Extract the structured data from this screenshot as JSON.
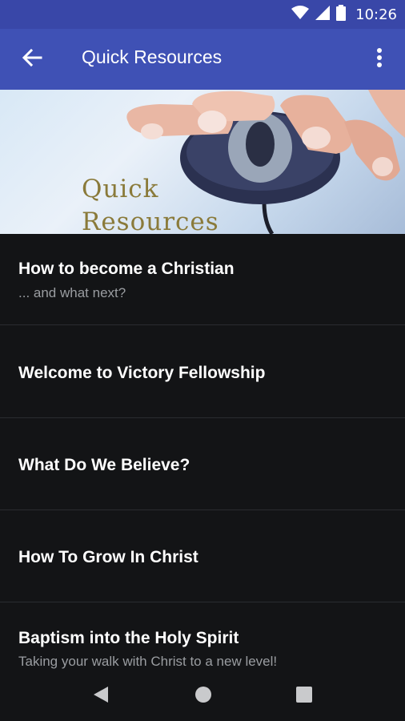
{
  "status_bar": {
    "time": "10:26",
    "icons": [
      "wifi-icon",
      "cell-signal-icon",
      "battery-icon"
    ]
  },
  "app_bar": {
    "title": "Quick Resources",
    "back_icon": "arrow-left-icon",
    "menu_icon": "more-vert-icon"
  },
  "hero": {
    "text_line1": "Quick",
    "text_line2": "Resources"
  },
  "list": {
    "items": [
      {
        "title": "How to become a Christian",
        "subtitle": "... and what next?"
      },
      {
        "title": "Welcome to Victory Fellowship",
        "subtitle": ""
      },
      {
        "title": "What Do We Believe?",
        "subtitle": ""
      },
      {
        "title": "How To Grow In Christ",
        "subtitle": ""
      },
      {
        "title": "Baptism into the Holy Spirit",
        "subtitle": "Taking your walk with Christ to a new level!"
      }
    ]
  },
  "nav_bar": {
    "icons": [
      "back-triangle-icon",
      "home-circle-icon",
      "recents-square-icon"
    ]
  },
  "colors": {
    "primary": "#3f51b5",
    "primary_dark": "#3947a8",
    "background": "#131416",
    "divider": "#2a2c30",
    "subtitle": "#9a9da1"
  }
}
